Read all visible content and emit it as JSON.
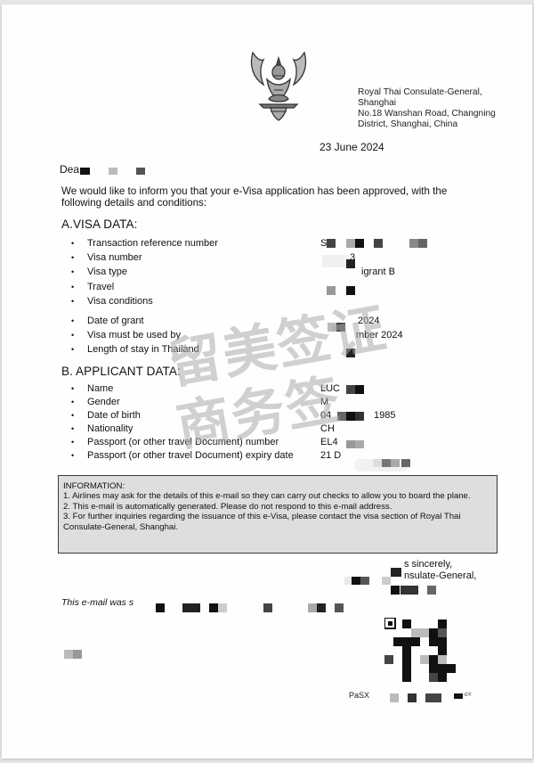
{
  "letterhead": {
    "emblem": "garuda-emblem",
    "address_lines": [
      "Royal Thai Consulate-General,",
      "Shanghai",
      "No.18 Wanshan Road, Changning",
      "District, Shanghai, China"
    ]
  },
  "date": "23 June 2024",
  "salutation": "Dea",
  "intro_text": "We would like to inform you that your e-Visa application has been approved, with the following details and conditions:",
  "visa_data": {
    "title": "A.VISA DATA:",
    "rows": [
      {
        "label": "Transaction reference number",
        "value": "S"
      },
      {
        "label": "Visa number",
        "value": "3"
      },
      {
        "label": "Visa type",
        "value": "igrant   B"
      },
      {
        "label": "Travel",
        "value": ""
      },
      {
        "label": "Visa conditions",
        "value": ""
      },
      {
        "label": "Date of grant",
        "value": "2024"
      },
      {
        "label": "Visa must be used by",
        "value": "mber 2024"
      },
      {
        "label": "Length of stay in Thailand",
        "value": ""
      }
    ]
  },
  "applicant_data": {
    "title": "B. APPLICANT DATA:",
    "rows": [
      {
        "label": "Name",
        "value": "LUC"
      },
      {
        "label": "Gender",
        "value": "M"
      },
      {
        "label": "Date of birth",
        "value": "04",
        "value_suffix": "1985"
      },
      {
        "label": "Nationality",
        "value": "CH"
      },
      {
        "label": "Passport (or other travel Document) number",
        "value": "EL4"
      },
      {
        "label": "Passport (or other travel Document) expiry date",
        "value": "21 D"
      }
    ]
  },
  "information": {
    "title": "INFORMATION:",
    "items": [
      "1.  Airlines may ask for the details of this e-mail so they can carry out checks to allow you to board the plane.",
      "2.  This e-mail is automatically generated. Please do not respond to this e-mail address.",
      "3.  For further inquiries regarding the issuance of this e-Visa, please contact the visa section of Royal Thai",
      "Consulate-General, Shanghai."
    ]
  },
  "closing": {
    "line1": "s sincerely,",
    "line2": "nsulate-General,"
  },
  "email_note": "This e-mail was s",
  "qr_caption_left": "PaSX",
  "qr_caption_right": "c=",
  "watermark": {
    "line1": "留美签证",
    "line2": "商务签"
  },
  "redaction_colors": [
    "#111111",
    "#2a2a2a",
    "#444444",
    "#666666",
    "#999999",
    "#bbbbbb"
  ]
}
